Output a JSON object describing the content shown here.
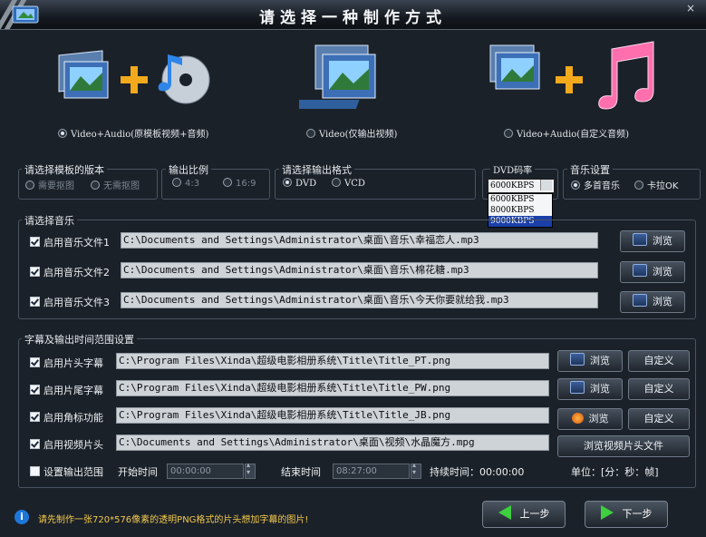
{
  "window": {
    "title": "请选择一种制作方式",
    "close_label": "×"
  },
  "modes": [
    {
      "label": "Video+Audio(原模板视频+音频)",
      "selected": true
    },
    {
      "label": "Video(仅输出视频)",
      "selected": false
    },
    {
      "label": "Video+Audio(自定义音频)",
      "selected": false
    }
  ],
  "template_version": {
    "label": "请选择模板的版本",
    "options": [
      "需要抠图",
      "无需抠图"
    ]
  },
  "aspect_ratio": {
    "label": "输出比例",
    "options": [
      "4:3",
      "16:9"
    ]
  },
  "output_format": {
    "label": "请选择输出格式",
    "options": [
      "DVD",
      "VCD"
    ],
    "selected": "DVD"
  },
  "dvd_bitrate": {
    "label": "DVD码率",
    "value": "6000KBPS",
    "options": [
      "6000KBPS",
      "8000KBPS",
      "9000KBPS"
    ],
    "highlighted": "9000KBPS"
  },
  "music_setting": {
    "label": "音乐设置",
    "options": [
      "多首音乐",
      "卡拉OK"
    ],
    "selected": "多首音乐"
  },
  "music": {
    "section_label": "请选择音乐",
    "browse_label": "浏览",
    "files": [
      {
        "label": "启用音乐文件1",
        "path": "C:\\Documents and Settings\\Administrator\\桌面\\音乐\\幸福恋人.mp3"
      },
      {
        "label": "启用音乐文件2",
        "path": "C:\\Documents and Settings\\Administrator\\桌面\\音乐\\棉花糖.mp3"
      },
      {
        "label": "启用音乐文件3",
        "path": "C:\\Documents and Settings\\Administrator\\桌面\\音乐\\今天你要就给我.mp3"
      }
    ]
  },
  "subtitle": {
    "section_label": "字幕及输出时间范围设置",
    "browse_label": "浏览",
    "custom_label": "自定义",
    "rows": [
      {
        "label": "启用片头字幕",
        "path": "C:\\Program Files\\Xinda\\超级电影相册系统\\Title\\Title_PT.png"
      },
      {
        "label": "启用片尾字幕",
        "path": "C:\\Program Files\\Xinda\\超级电影相册系统\\Title\\Title_PW.png"
      },
      {
        "label": "启用角标功能",
        "path": "C:\\Program Files\\Xinda\\超级电影相册系统\\Title\\Title_JB.png"
      }
    ],
    "intro": {
      "label": "启用视频片头",
      "path": "C:\\Documents and Settings\\Administrator\\桌面\\视频\\水晶魔方.mpg",
      "button_label": "浏览视频片头文件"
    }
  },
  "output_range": {
    "label": "设置输出范围",
    "start_label": "开始时间",
    "start_value": "00:00:00",
    "end_label": "结束时间",
    "end_value": "08:27:00",
    "duration_text": "持续时间：00:00:00",
    "unit_text": "单位：[分：秒：帧]"
  },
  "hint": {
    "icon": "i",
    "text": "请先制作一张720*576像素的透明PNG格式的片头想加字幕的图片!"
  },
  "nav": {
    "prev_label": "上一步",
    "next_label": "下一步"
  },
  "colors": {
    "accent_green": "#3fcf3f",
    "hint_yellow": "#f2c94c",
    "background": "#1b2129"
  }
}
